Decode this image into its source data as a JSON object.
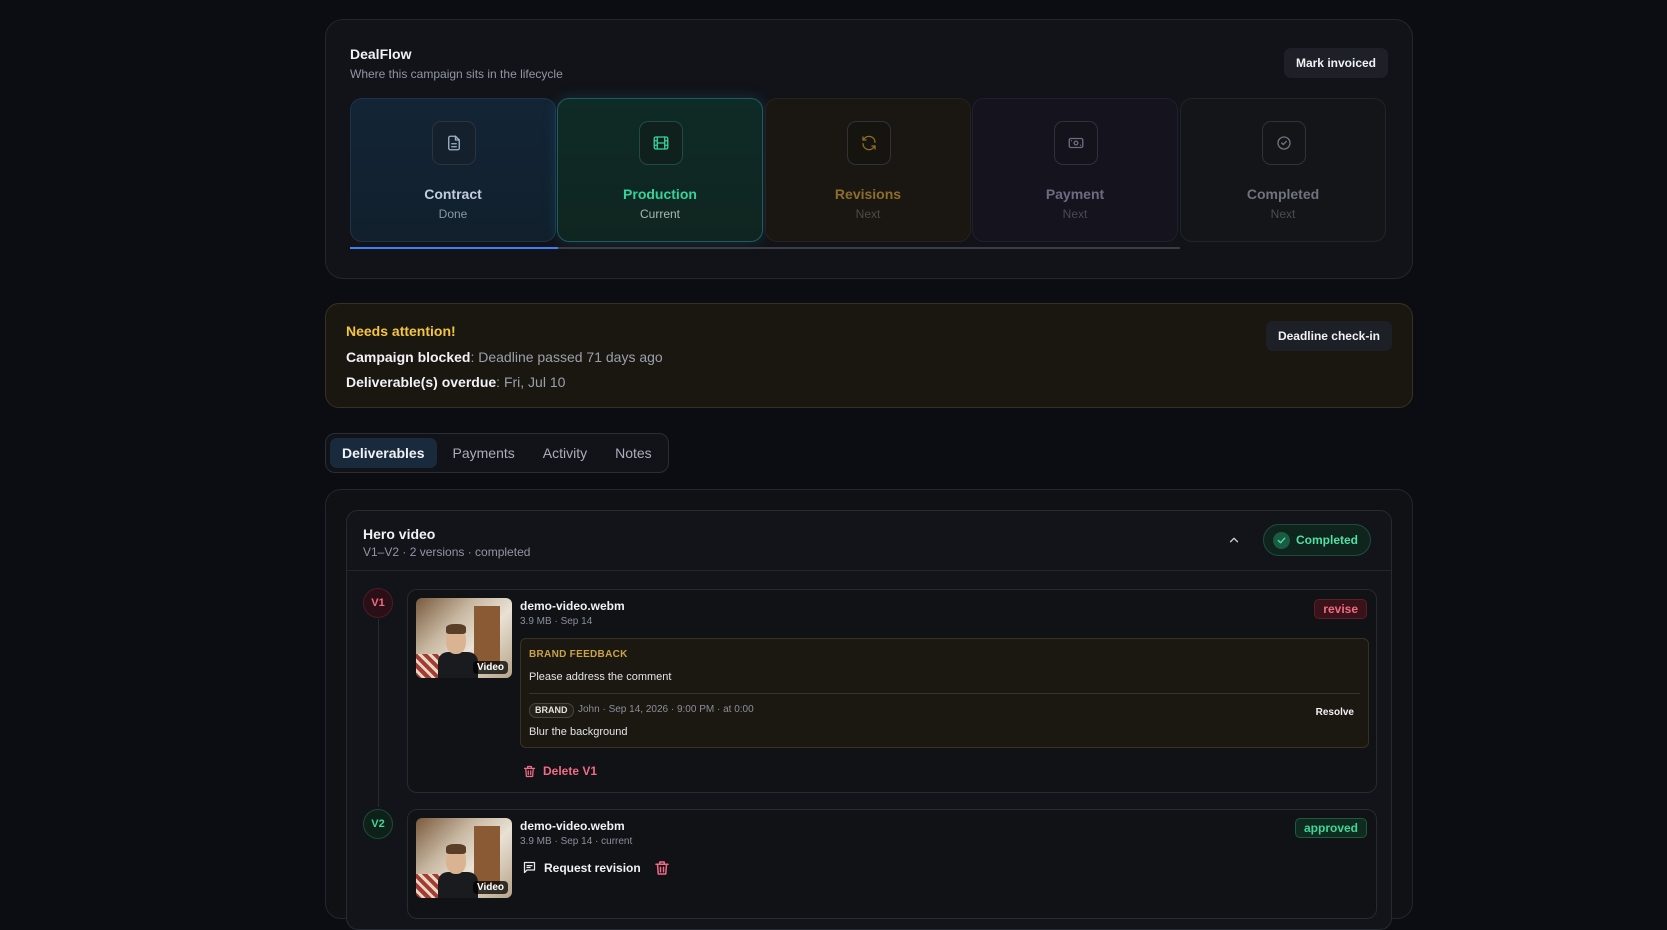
{
  "dealflow": {
    "title": "DealFlow",
    "subtitle": "Where this campaign sits in the lifecycle",
    "mark_invoiced_label": "Mark invoiced",
    "stages": [
      {
        "label": "Contract",
        "status": "Done",
        "icon": "document-icon"
      },
      {
        "label": "Production",
        "status": "Current",
        "icon": "film-icon"
      },
      {
        "label": "Revisions",
        "status": "Next",
        "icon": "refresh-icon"
      },
      {
        "label": "Payment",
        "status": "Next",
        "icon": "money-icon"
      },
      {
        "label": "Completed",
        "status": "Next",
        "icon": "check-circle-icon"
      }
    ],
    "progress_fraction": 0.25
  },
  "attention": {
    "title": "Needs attention!",
    "line1_label": "Campaign blocked",
    "line1_value": ": Deadline passed 71 days ago",
    "line2_label": "Deliverable(s) overdue",
    "line2_value": ": Fri, Jul 10",
    "button_label": "Deadline check-in"
  },
  "tabs": [
    {
      "label": "Deliverables",
      "active": true
    },
    {
      "label": "Payments",
      "active": false
    },
    {
      "label": "Activity",
      "active": false
    },
    {
      "label": "Notes",
      "active": false
    }
  ],
  "deliverable": {
    "title": "Hero video",
    "subtitle": "V1–V2 · 2 versions · completed",
    "status_label": "Completed",
    "versions": [
      {
        "badge": "V1",
        "filename": "demo-video.webm",
        "meta": "3.9 MB · Sep 14",
        "thumb_tag": "Video",
        "status": "revise",
        "feedback_title": "BRAND FEEDBACK",
        "feedback_text": "Please address the comment",
        "comment_tag": "BRAND",
        "comment_meta": "John · Sep 14, 2026 · 9:00 PM · at 0:00",
        "comment_body": "Blur the background",
        "resolve_label": "Resolve",
        "delete_label": "Delete V1"
      },
      {
        "badge": "V2",
        "filename": "demo-video.webm",
        "meta": "3.9 MB · Sep 14 · current",
        "thumb_tag": "Video",
        "status": "approved",
        "request_label": "Request revision"
      }
    ]
  },
  "colors": {
    "accent_blue": "#3b82f6",
    "current_green": "#34d39a",
    "warning_yellow": "#f5c542",
    "danger_pink": "#f26b86"
  }
}
